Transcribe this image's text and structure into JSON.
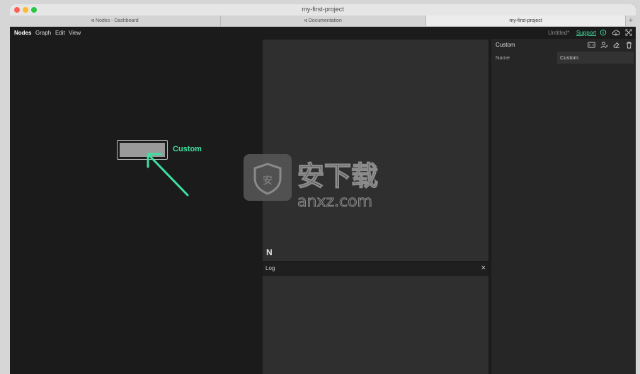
{
  "window": {
    "title": "my-first-project"
  },
  "tabs": [
    {
      "label": "Nodes - Dashboard",
      "icon": "nodes-icon",
      "active": false
    },
    {
      "label": "Documentation",
      "icon": "nodes-icon",
      "active": false
    },
    {
      "label": "my-first-project",
      "icon": "",
      "active": true
    }
  ],
  "tab_add_label": "+",
  "menubar": {
    "items": [
      "Nodes",
      "Graph",
      "Edit",
      "View"
    ],
    "doc_title": "Untitled*",
    "support_label": "Support",
    "icons": [
      "info-icon",
      "cloud-upload-icon",
      "fullscreen-icon"
    ]
  },
  "canvas": {
    "node": {
      "label": "Custom"
    }
  },
  "preview": {
    "logo_text": "N",
    "watermark_text": "安下载",
    "watermark_sub": "anxz.com"
  },
  "log": {
    "title": "Log",
    "close_label": "×"
  },
  "inspector": {
    "title": "Custom",
    "icons": [
      "code-icon",
      "user-icon",
      "erase-icon",
      "trash-icon"
    ],
    "properties": [
      {
        "name": "Name",
        "value": "Custom"
      }
    ]
  },
  "colors": {
    "accent": "#3ee0a0",
    "background": "#1b1b1b",
    "panel": "#2f2f2f"
  }
}
